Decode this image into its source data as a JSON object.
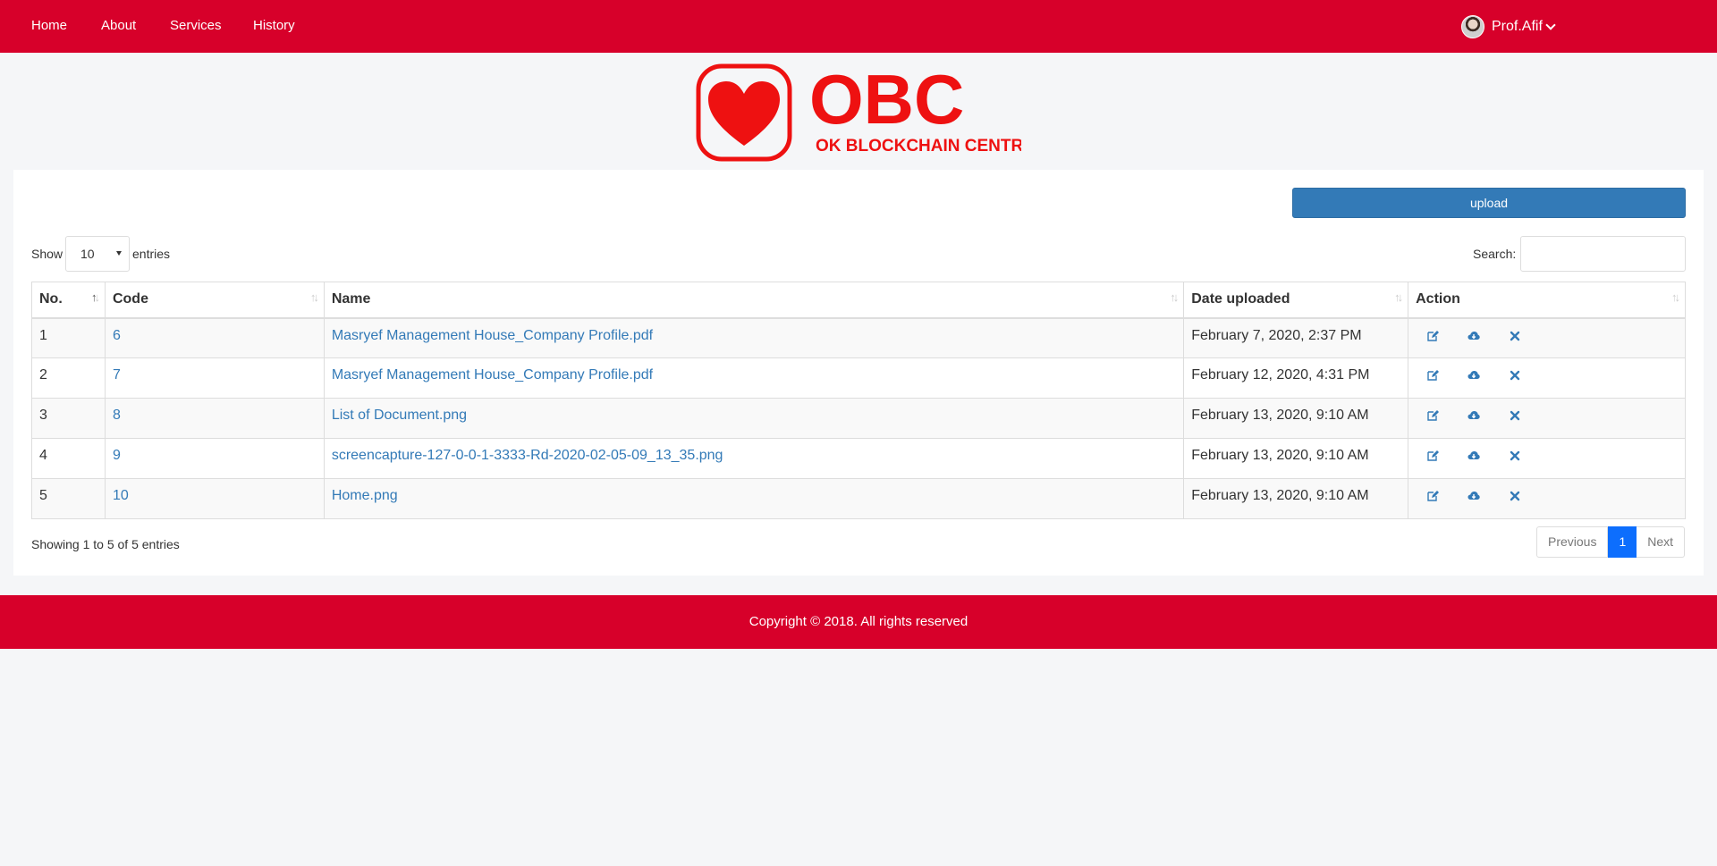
{
  "nav": {
    "items": [
      {
        "label": "Home"
      },
      {
        "label": "About"
      },
      {
        "label": "Services"
      },
      {
        "label": "History"
      }
    ],
    "user": {
      "name": "Prof.Afif"
    }
  },
  "logo": {
    "title": "OBC",
    "subtitle": "OK BLOCKCHAIN CENTRE",
    "icon": "heart-icon"
  },
  "toolbar": {
    "upload_label": "upload"
  },
  "table_controls": {
    "show_label": "Show",
    "length_value": "10",
    "entries_label": "entries",
    "search_label": "Search:",
    "search_value": ""
  },
  "table": {
    "headers": [
      "No.",
      "Code",
      "Name",
      "Date uploaded",
      "Action"
    ],
    "rows": [
      {
        "no": "1",
        "code": "6",
        "name": "Masryef Management House_Company Profile.pdf",
        "date": "February 7, 2020, 2:37 PM"
      },
      {
        "no": "2",
        "code": "7",
        "name": "Masryef Management House_Company Profile.pdf",
        "date": "February 12, 2020, 4:31 PM"
      },
      {
        "no": "3",
        "code": "8",
        "name": "List of Document.png",
        "date": "February 13, 2020, 9:10 AM"
      },
      {
        "no": "4",
        "code": "9",
        "name": "screencapture-127-0-0-1-3333-Rd-2020-02-05-09_13_35.png",
        "date": "February 13, 2020, 9:10 AM"
      },
      {
        "no": "5",
        "code": "10",
        "name": "Home.png",
        "date": "February 13, 2020, 9:10 AM"
      }
    ],
    "action_icons": [
      "edit-icon",
      "cloud-download-icon",
      "delete-icon"
    ]
  },
  "pagination": {
    "info": "Showing 1 to 5 of 5 entries",
    "previous": "Previous",
    "current": "1",
    "next": "Next"
  },
  "footer": {
    "text": "Copyright © 2018. All rights reserved"
  },
  "colors": {
    "brand": "#d7002a",
    "link": "#337ab7",
    "primary": "#337ab7",
    "page_active": "#0d6efd"
  }
}
